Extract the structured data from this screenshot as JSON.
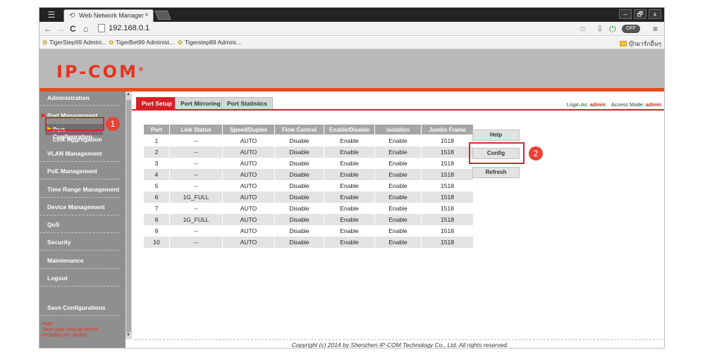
{
  "browser": {
    "tab_title": "Web Network Manager",
    "tab_close": "×",
    "url": "192.168.0.1",
    "toggle_label": "OFF",
    "window_controls": [
      "–",
      "🗗",
      "x"
    ]
  },
  "bookmarks": {
    "items": [
      "TigerStep99 Admini...",
      "TigerBet99 Administ...",
      "Tigerstep89 Admini..."
    ],
    "folder": "บุ๊กมาร์กอื่นๆ"
  },
  "brand": {
    "logo": "IP-COM",
    "trademark": "®"
  },
  "sidebar": {
    "administration": "Administration",
    "port_management": "Port Management",
    "port_configuration": "Port Configuration",
    "link_aggregation": "Link Aggregation",
    "vlan": "VLAN Management",
    "poe": "PoE Management",
    "time_range": "Time Range Management",
    "device": "Device Management",
    "qos": "QoS",
    "security": "Security",
    "maintenance": "Maintenance",
    "logout": "Logout",
    "save": "Save Configurations",
    "note_title": "Note:",
    "note_line1": "Save your settings before",
    "note_line2": "restarting the device."
  },
  "tabs": [
    "Port Setup",
    "Port Mirroring",
    "Port Statistics"
  ],
  "login": {
    "login_label": "Login As:",
    "login_value": "admin",
    "access_label": "Access Mode:",
    "access_value": "admin"
  },
  "table": {
    "headers": [
      "Port",
      "Link Status",
      "Speed/Duplex",
      "Flow Control",
      "Enable/Disable",
      "Isolation",
      "Jumbo Frame"
    ],
    "rows": [
      [
        "1",
        "--",
        "AUTO",
        "Disable",
        "Enable",
        "Enable",
        "1518"
      ],
      [
        "2",
        "--",
        "AUTO",
        "Disable",
        "Enable",
        "Enable",
        "1518"
      ],
      [
        "3",
        "--",
        "AUTO",
        "Disable",
        "Enable",
        "Enable",
        "1518"
      ],
      [
        "4",
        "--",
        "AUTO",
        "Disable",
        "Enable",
        "Enable",
        "1518"
      ],
      [
        "5",
        "--",
        "AUTO",
        "Disable",
        "Enable",
        "Enable",
        "1518"
      ],
      [
        "6",
        "1G_FULL",
        "AUTO",
        "Disable",
        "Enable",
        "Enable",
        "1518"
      ],
      [
        "7",
        "--",
        "AUTO",
        "Disable",
        "Enable",
        "Enable",
        "1518"
      ],
      [
        "8",
        "1G_FULL",
        "AUTO",
        "Disable",
        "Enable",
        "Enable",
        "1518"
      ],
      [
        "9",
        "--",
        "AUTO",
        "Disable",
        "Enable",
        "Enable",
        "1518"
      ],
      [
        "10",
        "--",
        "AUTO",
        "Disable",
        "Enable",
        "Enable",
        "1518"
      ]
    ]
  },
  "buttons": {
    "help": "Help",
    "config": "Config",
    "refresh": "Refresh"
  },
  "markers": {
    "one": "1",
    "two": "2"
  },
  "footer": "Copyright (c) 2014 by Shenzhen IP-COM Technology Co., Ltd. All rights reserved.",
  "colors": {
    "brand_red": "#d81f26",
    "sidebar_gray": "#8f8f8f",
    "banner_gray": "#b9b9b9",
    "orange_bar": "#e64b1e"
  }
}
